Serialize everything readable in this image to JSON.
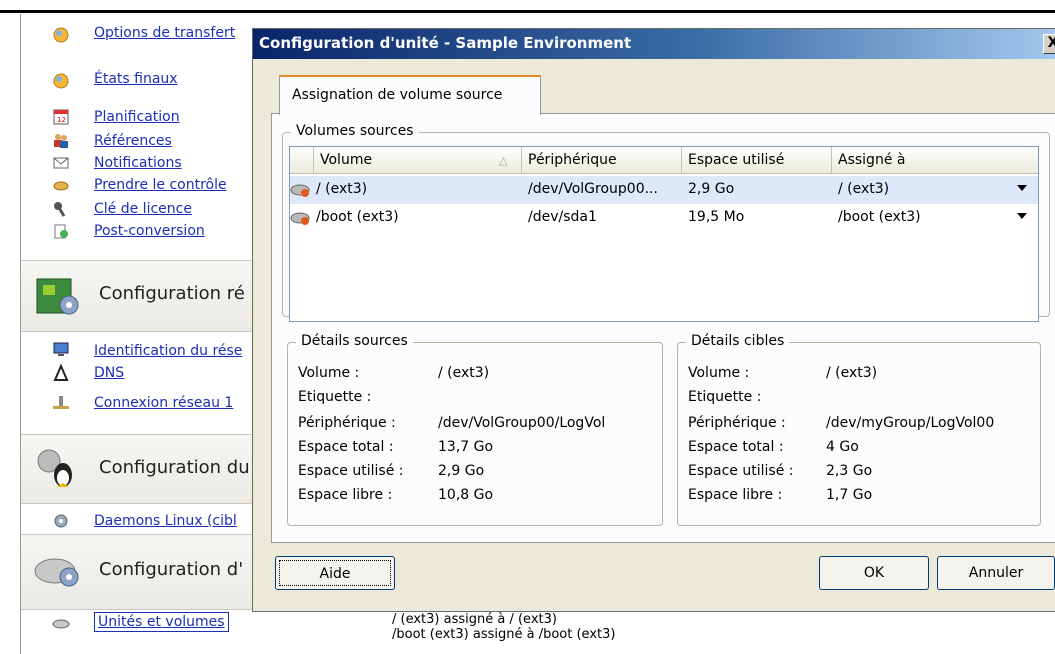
{
  "left_nav": {
    "top_links": [
      {
        "label": "Options de transfert",
        "icon": "globe-icon"
      },
      {
        "label": "États finaux",
        "icon": "globe-icon"
      },
      {
        "label": "Planification",
        "icon": "calendar-icon"
      },
      {
        "label": "Références",
        "icon": "users-icon"
      },
      {
        "label": "Notifications",
        "icon": "envelope-icon"
      },
      {
        "label": "Prendre le contrôle",
        "icon": "handshake-icon"
      },
      {
        "label": "Clé de licence",
        "icon": "key-icon"
      },
      {
        "label": "Post-conversion",
        "icon": "script-icon"
      }
    ],
    "section_network": {
      "title": "Configuration ré",
      "icon": "network-card-icon"
    },
    "network_links": [
      {
        "label": "Identification du rése",
        "icon": "computer-icon"
      },
      {
        "label": "DNS",
        "icon": "dns-icon"
      },
      {
        "label": "Connexion réseau 1",
        "icon": "network-connection-icon"
      }
    ],
    "section_linux": {
      "title": "Configuration du",
      "icon": "linux-penguin-icon"
    },
    "linux_links": [
      {
        "label": "Daemons Linux (cibl",
        "icon": "gear-icon"
      }
    ],
    "section_drive": {
      "title": "Configuration d'",
      "icon": "drive-gear-icon"
    },
    "drive_links": [
      {
        "label": "Unités et volumes",
        "icon": "drive-icon"
      }
    ]
  },
  "dialog": {
    "title": "Configuration d'unité - Sample Environment",
    "close_label": "X",
    "tab_label": "Assignation de volume source",
    "volumes_group_label": "Volumes sources",
    "columns": [
      "Volume",
      "Périphérique",
      "Espace utilisé",
      "Assigné à"
    ],
    "rows": [
      {
        "volume": "/ (ext3)",
        "device": "/dev/VolGroup00...",
        "used": "2,9 Go",
        "assigned": "/ (ext3)",
        "selected": true
      },
      {
        "volume": "/boot (ext3)",
        "device": "/dev/sda1",
        "used": "19,5 Mo",
        "assigned": "/boot (ext3)",
        "selected": false
      }
    ],
    "source_details": {
      "label": "Détails sources",
      "rows": [
        {
          "label": "Volume :",
          "value": "/ (ext3)"
        },
        {
          "label": "Etiquette :",
          "value": ""
        },
        {
          "label": "Périphérique :",
          "value": "/dev/VolGroup00/LogVol"
        },
        {
          "label": "Espace total :",
          "value": "13,7 Go"
        },
        {
          "label": "Espace utilisé :",
          "value": "2,9 Go"
        },
        {
          "label": "Espace libre :",
          "value": "10,8 Go"
        }
      ]
    },
    "target_details": {
      "label": "Détails cibles",
      "rows": [
        {
          "label": "Volume :",
          "value": "/ (ext3)"
        },
        {
          "label": "Etiquette :",
          "value": ""
        },
        {
          "label": "Périphérique :",
          "value": "/dev/myGroup/LogVol00"
        },
        {
          "label": "Espace total :",
          "value": "4 Go"
        },
        {
          "label": "Espace utilisé :",
          "value": "2,3 Go"
        },
        {
          "label": "Espace libre :",
          "value": "1,7 Go"
        }
      ]
    },
    "buttons": {
      "help": "Aide",
      "ok": "OK",
      "cancel": "Annuler"
    }
  },
  "status_log": [
    "/ (ext3) assigné à / (ext3)",
    "/boot (ext3) assigné à /boot (ext3)"
  ]
}
